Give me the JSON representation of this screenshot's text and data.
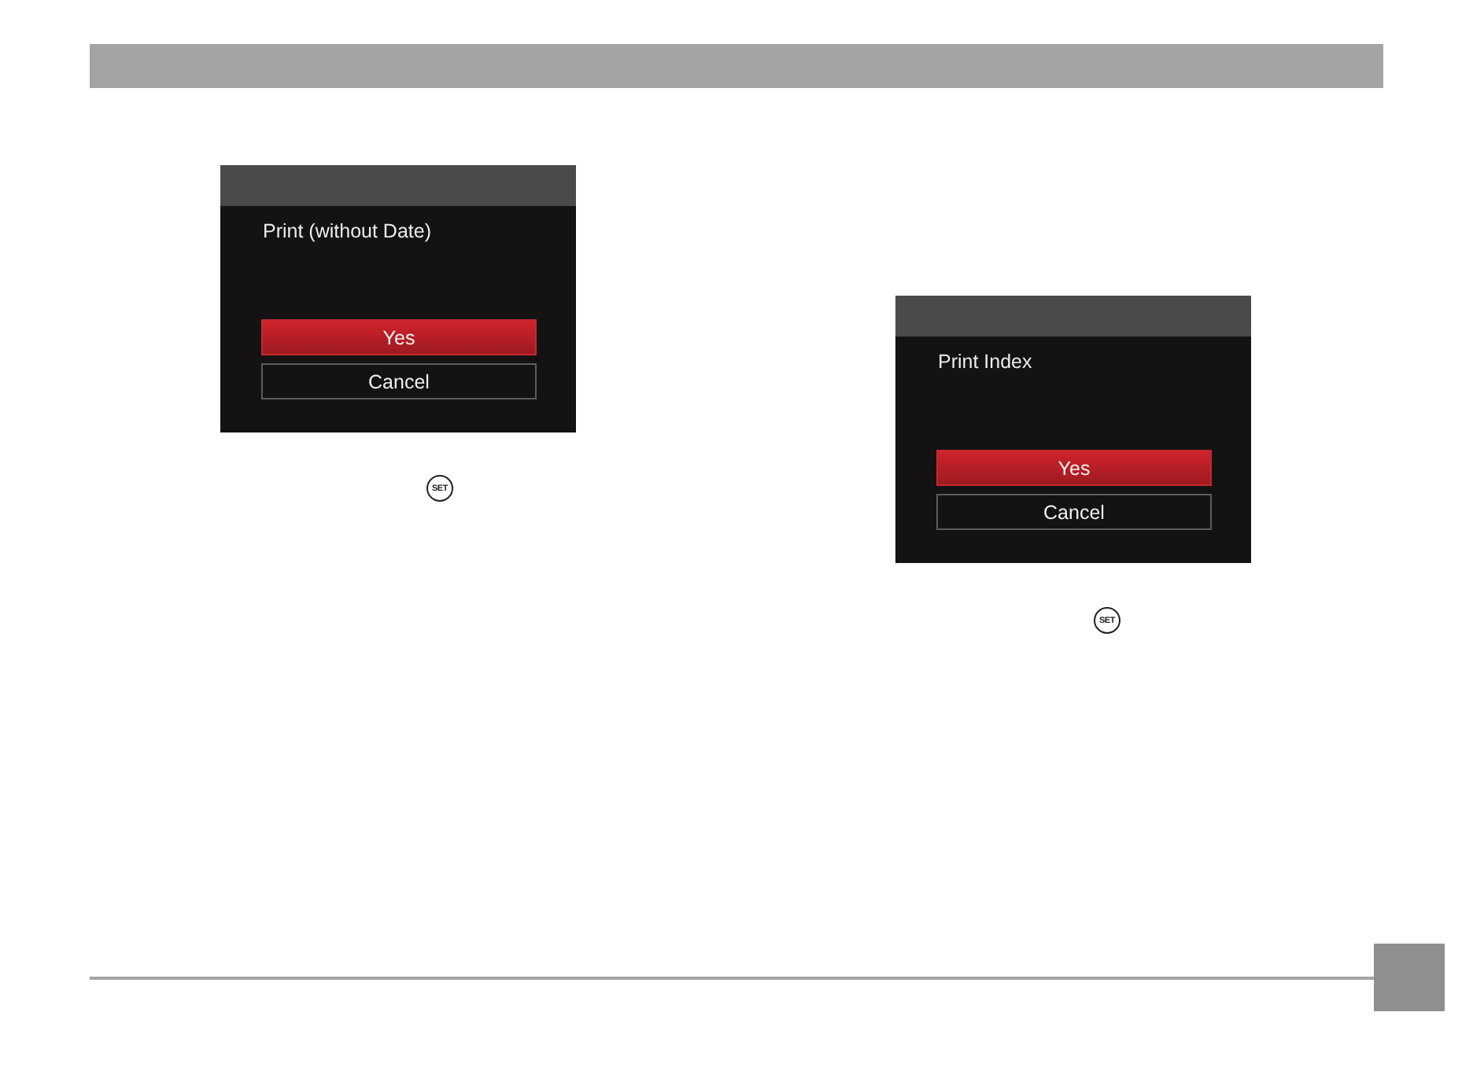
{
  "dialogs": [
    {
      "message": "Print (without Date)",
      "buttons": [
        {
          "label": "Yes",
          "selected": true
        },
        {
          "label": "Cancel",
          "selected": false
        }
      ],
      "set_key": "SET"
    },
    {
      "message": "Print Index",
      "buttons": [
        {
          "label": "Yes",
          "selected": true
        },
        {
          "label": "Cancel",
          "selected": false
        }
      ],
      "set_key": "SET"
    }
  ]
}
